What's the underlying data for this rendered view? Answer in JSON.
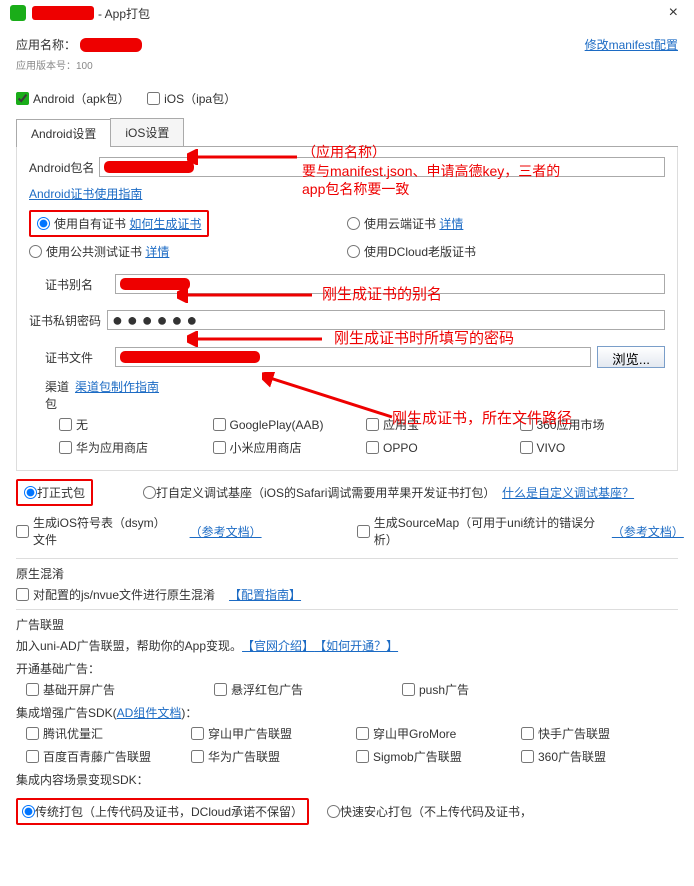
{
  "titlebar": {
    "suffix": " - App打包",
    "close": "×"
  },
  "header": {
    "appname_label": "应用名称：",
    "modify_link": "修改manifest配置",
    "version_note": "应用版本号：100"
  },
  "platforms": {
    "android": "Android（apk包）",
    "ios": "iOS（ipa包）"
  },
  "tabs": {
    "android": "Android设置",
    "ios": "iOS设置"
  },
  "fields": {
    "pkg_label": "Android包名",
    "cert_guide": "Android证书使用指南",
    "radio_own": "使用自有证书",
    "how_gen": "如何生成证书",
    "radio_cloud": "使用云端证书",
    "cloud_detail": "详情",
    "radio_public": "使用公共测试证书",
    "public_detail": "详情",
    "radio_old": "使用DCloud老版证书",
    "alias_label": "证书别名",
    "pwd_label": "证书私钥密码",
    "file_label": "证书文件",
    "browse": "浏览..."
  },
  "channel": {
    "title": "渠道包",
    "guide": "渠道包制作指南",
    "items": [
      "无",
      "GooglePlay(AAB)",
      "应用宝",
      "360应用市场",
      "华为应用商店",
      "小米应用商店",
      "OPPO",
      "VIVO"
    ]
  },
  "pack": {
    "formal": "打正式包",
    "custom": "打自定义调试基座（iOS的Safari调试需要用苹果开发证书打包）",
    "what_is": "什么是自定义调试基座？",
    "dsym": "生成iOS符号表（dsym）文件",
    "ref1": "（参考文档）",
    "sourcemap": "生成SourceMap（可用于uni统计的错误分析）",
    "ref2": "（参考文档）"
  },
  "obf": {
    "title": "原生混淆",
    "opt": "对配置的js/nvue文件进行原生混淆",
    "guide": "【配置指南】"
  },
  "ads": {
    "title": "广告联盟",
    "join": "加入uni-AD广告联盟，帮助你的App变现。",
    "intro": "【官网介绍】",
    "howopen": "【如何开通？】",
    "basic_title": "开通基础广告：",
    "basic": [
      "基础开屏广告",
      "悬浮红包广告",
      "push广告"
    ],
    "enhance_title": "集成增强广告SDK(",
    "enhance_link": "AD组件文档",
    "enhance_suffix": ")：",
    "enhance": [
      "腾讯优量汇",
      "穿山甲广告联盟",
      "穿山甲GroMore",
      "快手广告联盟",
      "百度百青藤广告联盟",
      "华为广告联盟",
      "Sigmob广告联盟",
      "360广告联盟"
    ],
    "scene_title": "集成内容场景变现SDK："
  },
  "bottompack": {
    "traditional": "传统打包（上传代码及证书，DCloud承诺不保留）",
    "fast": "快速安心打包（不上传代码及证书，"
  },
  "annotations": {
    "pkg1": "（应用名称）",
    "pkg2": "要与manifest.json、申请高德key，三者的",
    "pkg3": "app包名称要一致",
    "alias": "刚生成证书的别名",
    "pwd": "刚生成证书时所填写的密码",
    "file": "刚生成证书，所在文件路径"
  }
}
